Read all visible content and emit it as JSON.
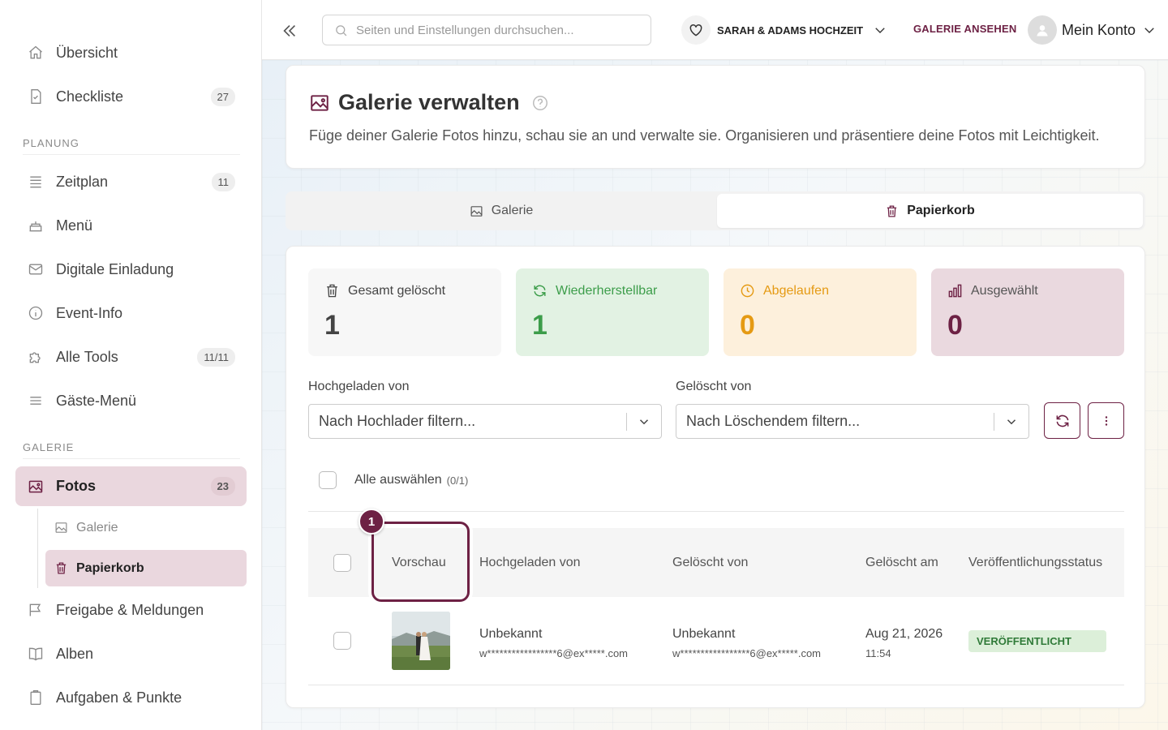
{
  "sidebar": {
    "items": [
      {
        "label": "Übersicht",
        "icon": "home-icon"
      },
      {
        "label": "Checkliste",
        "badge": "27",
        "icon": "checklist-icon"
      },
      {
        "label": "Zeitplan",
        "badge": "11",
        "icon": "list-icon"
      },
      {
        "label": "Menü",
        "icon": "cake-icon"
      },
      {
        "label": "Digitale Einladung",
        "icon": "mail-icon"
      },
      {
        "label": "Event-Info",
        "icon": "info-icon"
      },
      {
        "label": "Alle Tools",
        "badge": "11/11",
        "icon": "puzzle-icon"
      },
      {
        "label": "Gäste-Menü",
        "icon": "menu-icon"
      },
      {
        "label": "Fotos",
        "badge": "23",
        "icon": "image-icon"
      },
      {
        "label": "Freigabe & Meldungen",
        "icon": "flag-icon"
      },
      {
        "label": "Alben",
        "icon": "book-icon"
      },
      {
        "label": "Aufgaben & Punkte",
        "icon": "clipboard-icon"
      }
    ],
    "sections": {
      "planung": "PLANUNG",
      "galerie": "GALERIE"
    },
    "sub_items": [
      {
        "label": "Galerie",
        "icon": "image-icon"
      },
      {
        "label": "Papierkorb",
        "icon": "trash-icon"
      }
    ]
  },
  "topbar": {
    "search_placeholder": "Seiten und Einstellungen durchsuchen...",
    "event_name": "SARAH & ADAMS HOCHZEIT",
    "gallery_button": "GALERIE ANSEHEN",
    "account_label": "Mein Konto"
  },
  "header": {
    "title": "Galerie verwalten",
    "description": "Füge deiner Galerie Fotos hinzu, schau sie an und verwalte sie. Organisieren und präsentiere deine Fotos mit Leichtigkeit."
  },
  "tabs": [
    {
      "label": "Galerie",
      "active": false
    },
    {
      "label": "Papierkorb",
      "active": true
    }
  ],
  "stats": [
    {
      "label": "Gesamt gelöscht",
      "value": "1",
      "color": "#444444"
    },
    {
      "label": "Wiederherstellbar",
      "value": "1",
      "color": "#3c9d4a"
    },
    {
      "label": "Abgelaufen",
      "value": "0",
      "color": "#e59a13"
    },
    {
      "label": "Ausgewählt",
      "value": "0",
      "color": "#6d2144"
    }
  ],
  "filters": {
    "uploader_label": "Hochgeladen von",
    "uploader_placeholder": "Nach Hochlader filtern...",
    "deleter_label": "Gelöscht von",
    "deleter_placeholder": "Nach Löschendem filtern..."
  },
  "select_all": {
    "label": "Alle auswählen",
    "count": "(0/1)"
  },
  "table": {
    "headers": [
      "Vorschau",
      "Hochgeladen von",
      "Gelöscht von",
      "Gelöscht am",
      "Veröffentlichungsstatus"
    ],
    "rows": [
      {
        "uploaded_by_name": "Unbekannt",
        "uploaded_by_email": "w*****************6@ex*****.com",
        "deleted_by_name": "Unbekannt",
        "deleted_by_email": "w*****************6@ex*****.com",
        "deleted_date": "Aug 21, 2026",
        "deleted_time": "11:54",
        "status": "VERÖFFENTLICHT"
      }
    ]
  },
  "highlight": {
    "marker": "1"
  },
  "colors": {
    "accent": "#6d2144",
    "green": "#3c9d4a",
    "orange": "#e59a13"
  }
}
